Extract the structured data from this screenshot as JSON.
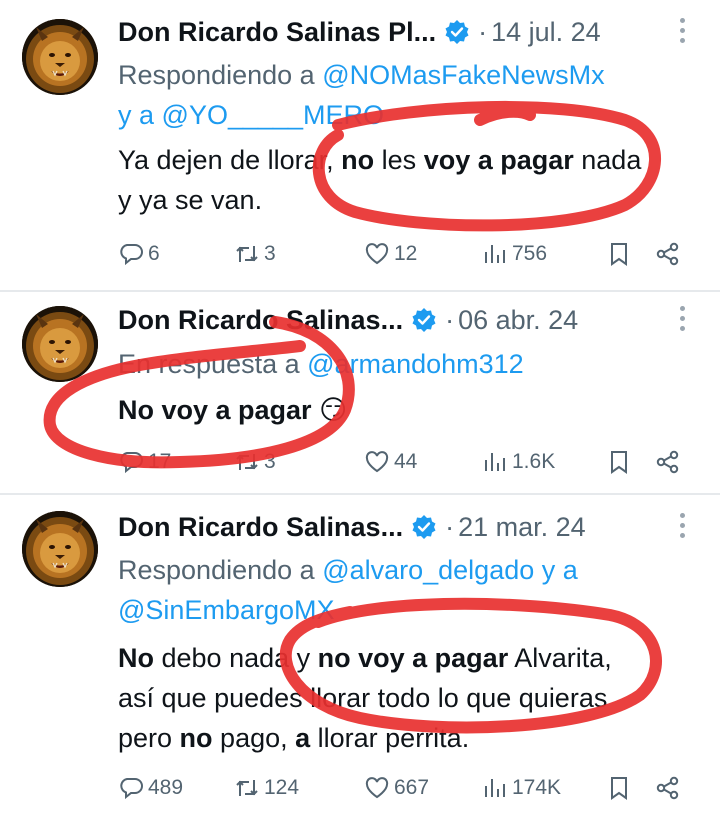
{
  "tweets": [
    {
      "name": "Don Ricardo Salinas Pl...",
      "date": "14 jul. 24",
      "reply_prefix": "Respondiendo a",
      "reply_line1_handle": "@NOMasFakeNewsMx",
      "reply_line2_prefix": "y a",
      "reply_line2_handle": "@YO_____MERO",
      "body_line1": [
        "Ya dejen de llorar, ",
        "no",
        " les ",
        "voy a pagar",
        " nada"
      ],
      "body_line2": "y ya se van.",
      "stats": {
        "replies": "6",
        "retweets": "3",
        "likes": "12",
        "views": "756"
      }
    },
    {
      "name": "Don Ricardo Salinas...",
      "date": "06 abr. 24",
      "reply_prefix": "En respuesta a",
      "reply_line1_handle": "@armandohm312",
      "body_text": "No voy a pagar",
      "emoji": "😏",
      "stats": {
        "replies": "17",
        "retweets": "3",
        "likes": "44",
        "views": "1.6K"
      }
    },
    {
      "name": "Don Ricardo Salinas...",
      "date": "21 mar. 24",
      "reply_prefix": "Respondiendo a",
      "reply_line1_handle": "@alvaro_delgado",
      "reply_line1_suffix": "y a",
      "reply_line2_handle": "@SinEmbargoMX",
      "body_line1": [
        "No",
        " debo nada y ",
        "no voy a pagar",
        " Alvarita,"
      ],
      "body_line2": "así que puedes llorar todo lo que quieras",
      "body_line3": [
        "pero ",
        "no",
        " pago, ",
        "a",
        " llorar perrita."
      ],
      "stats": {
        "replies": "489",
        "retweets": "124",
        "likes": "667",
        "views": "174K"
      }
    }
  ],
  "icons": [
    "verified-badge-icon",
    "reply-icon",
    "retweet-icon",
    "like-icon",
    "views-icon",
    "bookmark-icon",
    "share-icon",
    "more-icon"
  ],
  "colors": {
    "link": "#1d9bf0",
    "muted": "#536471",
    "text": "#0f1419",
    "scribble": "#e8302f"
  }
}
